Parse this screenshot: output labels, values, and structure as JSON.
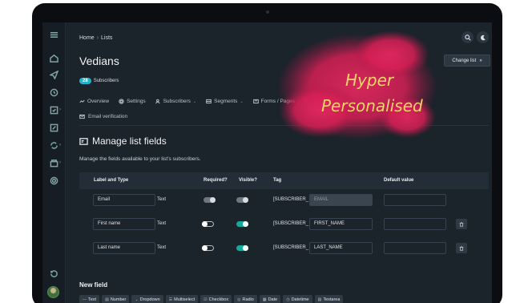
{
  "breadcrumb": {
    "home": "Home",
    "separator": "›",
    "current": "Lists"
  },
  "page": {
    "title": "Vedians",
    "subscriber_count": "28",
    "subscriber_label": "Subscribers",
    "change_list_label": "Change list",
    "change_list_icon": "»"
  },
  "tabs": [
    {
      "label": "Overview",
      "icon": "overview-icon"
    },
    {
      "label": "Settings",
      "icon": "gear-icon"
    },
    {
      "label": "Subscribers",
      "icon": "users-icon",
      "chevron": "⌄"
    },
    {
      "label": "Segments",
      "icon": "segments-icon",
      "chevron": "⌄"
    },
    {
      "label": "Forms / Pages",
      "icon": "forms-icon"
    },
    {
      "label": "Manage list fields",
      "icon": "fields-icon"
    }
  ],
  "tab_email_verification": "Email verification",
  "section": {
    "title": "Manage list fields",
    "description": "Manage the fields available to your list's subscribers."
  },
  "table": {
    "headers": {
      "label_type": "Label and Type",
      "required": "Required?",
      "visible": "Visible?",
      "tag": "Tag",
      "default": "Default value"
    },
    "rows": [
      {
        "label": "Email",
        "type": "Text",
        "required": "disabled-on",
        "visible": "disabled-on",
        "tag_prefix": "[SUBSCRIBER_",
        "tag": "EMAIL",
        "tag_disabled": true,
        "deletable": false
      },
      {
        "label": "First name",
        "type": "Text",
        "required": "off",
        "visible": "on",
        "tag_prefix": "[SUBSCRIBER_",
        "tag": "FIRST_NAME",
        "tag_disabled": false,
        "deletable": true
      },
      {
        "label": "Last name",
        "type": "Text",
        "required": "off",
        "visible": "on",
        "tag_prefix": "[SUBSCRIBER_",
        "tag": "LAST_NAME",
        "tag_disabled": false,
        "deletable": true
      }
    ]
  },
  "new_field": {
    "title": "New field",
    "types": [
      {
        "label": "Text",
        "icon": "—"
      },
      {
        "label": "Number",
        "icon": "▤"
      },
      {
        "label": "Dropdown",
        "icon": "⌄"
      },
      {
        "label": "Multiselect",
        "icon": "☰"
      },
      {
        "label": "Checkbox",
        "icon": "☑"
      },
      {
        "label": "Radio",
        "icon": "◎"
      },
      {
        "label": "Date",
        "icon": "▦"
      },
      {
        "label": "Datetime",
        "icon": "◷"
      },
      {
        "label": "Textarea",
        "icon": "▤"
      }
    ]
  },
  "promo": {
    "line1": "Hyper",
    "line2": "Personalised"
  },
  "colors": {
    "accent": "#22b3c8",
    "toggle_on": "#18a89a",
    "promo_text": "#f1d36a",
    "splash": "#e0285e"
  }
}
